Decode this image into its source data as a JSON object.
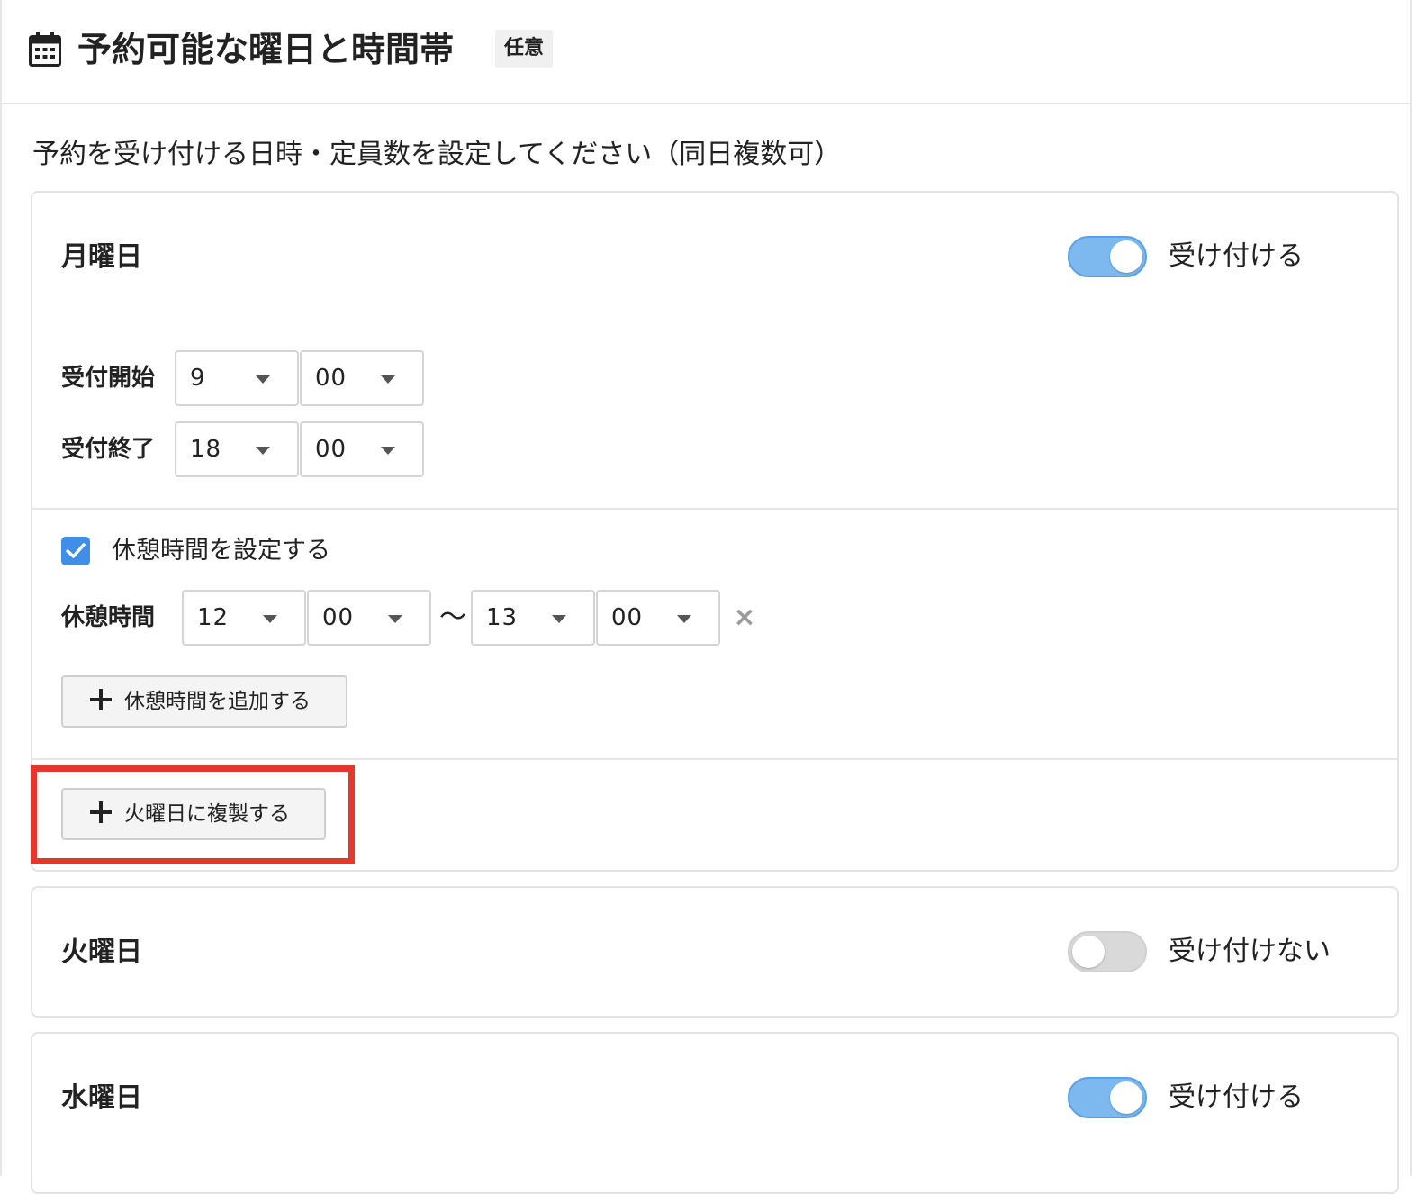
{
  "header": {
    "title": "予約可能な曜日と時間帯",
    "badge": "任意",
    "icon": "calendar-icon"
  },
  "description": "予約を受け付ける日時・定員数を設定してください（同日複数可）",
  "days": {
    "monday": {
      "name": "月曜日",
      "enabled": true,
      "status_label": "受け付ける",
      "start_label": "受付開始",
      "start_hour": "9",
      "start_minute": "00",
      "end_label": "受付終了",
      "end_hour": "18",
      "end_minute": "00",
      "break_enabled": true,
      "break_checkbox_label": "休憩時間を設定する",
      "break_label": "休憩時間",
      "break_from_hour": "12",
      "break_from_minute": "00",
      "break_separator": "〜",
      "break_to_hour": "13",
      "break_to_minute": "00",
      "remove_symbol": "×",
      "add_break_button": "休憩時間を追加する",
      "copy_button": "火曜日に複製する"
    },
    "tuesday": {
      "name": "火曜日",
      "enabled": false,
      "status_label": "受け付けない"
    },
    "wednesday": {
      "name": "水曜日",
      "enabled": true,
      "status_label": "受け付ける"
    }
  },
  "colors": {
    "toggle_on": "#7db9ef",
    "toggle_off": "#d9d9d9",
    "checkbox": "#3f8ee8",
    "highlight": "#e23a2a"
  }
}
